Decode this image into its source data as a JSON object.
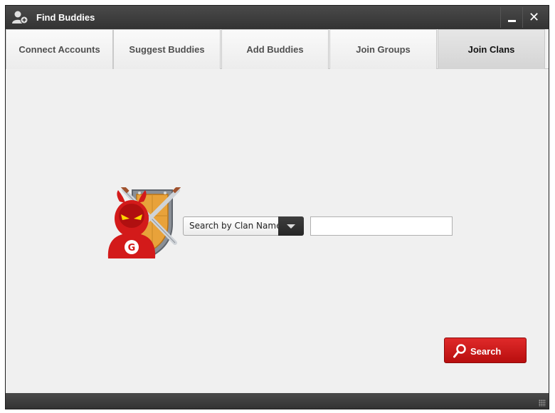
{
  "window": {
    "title": "Find Buddies",
    "title_icon": "add-user-icon",
    "minimize_icon": "minimize-icon",
    "close_icon": "close-icon",
    "close_glyph": "✕"
  },
  "tabs": [
    {
      "label": "Connect Accounts",
      "active": false
    },
    {
      "label": "Suggest Buddies",
      "active": false
    },
    {
      "label": "Add Buddies",
      "active": false
    },
    {
      "label": "Join Groups",
      "active": false
    },
    {
      "label": "Join Clans",
      "active": true
    }
  ],
  "search": {
    "mode_selected": "Search by Clan Name",
    "input_value": "",
    "input_placeholder": "",
    "button_label": "Search",
    "button_icon": "search-icon",
    "mascot_icon": "clan-mascot-icon"
  },
  "colors": {
    "accent": "#cc1a1a",
    "titlebar": "#3a3a3a",
    "content_bg": "#f0f0f0"
  }
}
